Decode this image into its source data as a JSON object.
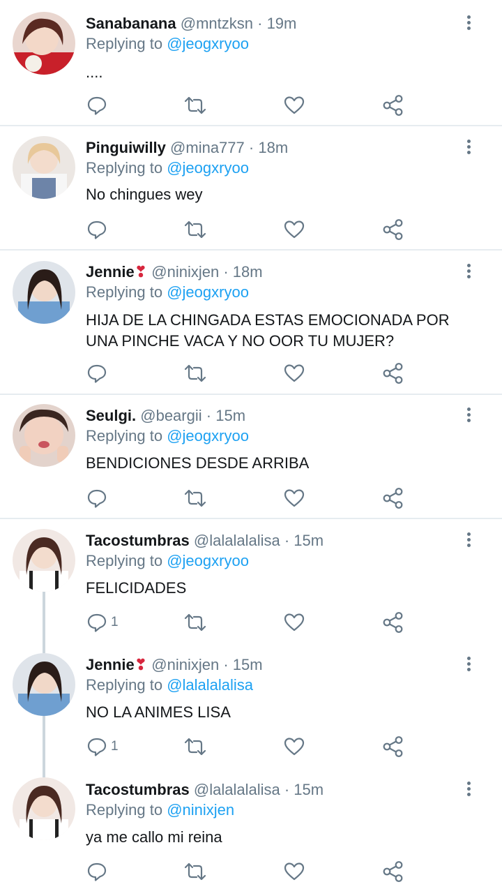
{
  "tweets": [
    {
      "name": "Sanabanana",
      "emoji": "",
      "handle": "@mntzksn",
      "time": "19m",
      "replying_prefix": "Replying to",
      "replying_to": "@jeogxryoo",
      "lines": [
        "...."
      ],
      "reply_count": ""
    },
    {
      "name": "Pinguiwilly",
      "emoji": "",
      "handle": "@mina777",
      "time": "18m",
      "replying_prefix": "Replying to",
      "replying_to": "@jeogxryoo",
      "lines": [
        "No chingues wey"
      ],
      "reply_count": ""
    },
    {
      "name": "Jennie",
      "emoji": "❣",
      "handle": "@ninixjen",
      "time": "18m",
      "replying_prefix": "Replying to",
      "replying_to": "@jeogxryoo",
      "lines": [
        "HIJA DE LA CHINGADA ESTAS EMOCIONADA POR",
        "UNA PINCHE VACA Y NO OOR TU MUJER?"
      ],
      "reply_count": ""
    },
    {
      "name": "Seulgi.",
      "emoji": "",
      "handle": "@beargii",
      "time": "15m",
      "replying_prefix": "Replying to",
      "replying_to": "@jeogxryoo",
      "lines": [
        "BENDICIONES DESDE ARRIBA"
      ],
      "reply_count": ""
    },
    {
      "name": "Tacostumbras",
      "emoji": "",
      "handle": "@lalalalalisa",
      "time": "15m",
      "replying_prefix": "Replying to",
      "replying_to": "@jeogxryoo",
      "lines": [
        "FELICIDADES"
      ],
      "reply_count": "1"
    },
    {
      "name": "Jennie",
      "emoji": "❣",
      "handle": "@ninixjen",
      "time": "15m",
      "replying_prefix": "Replying to",
      "replying_to": "@lalalalalisa",
      "lines": [
        "NO LA ANIMES LISA"
      ],
      "reply_count": "1"
    },
    {
      "name": "Tacostumbras",
      "emoji": "",
      "handle": "@lalalalalisa",
      "time": "15m",
      "replying_prefix": "Replying to",
      "replying_to": "@ninixjen",
      "lines": [
        "ya me callo mi reina"
      ],
      "reply_count": ""
    }
  ],
  "separator": "·",
  "icons": {
    "reply": "reply-icon",
    "retweet": "retweet-icon",
    "like": "like-icon",
    "share": "share-icon",
    "more": "more-icon"
  },
  "colors": {
    "mention": "#1da1f2",
    "muted": "#657786",
    "divider": "#e6ecf0",
    "emoji": "#d7263d"
  }
}
